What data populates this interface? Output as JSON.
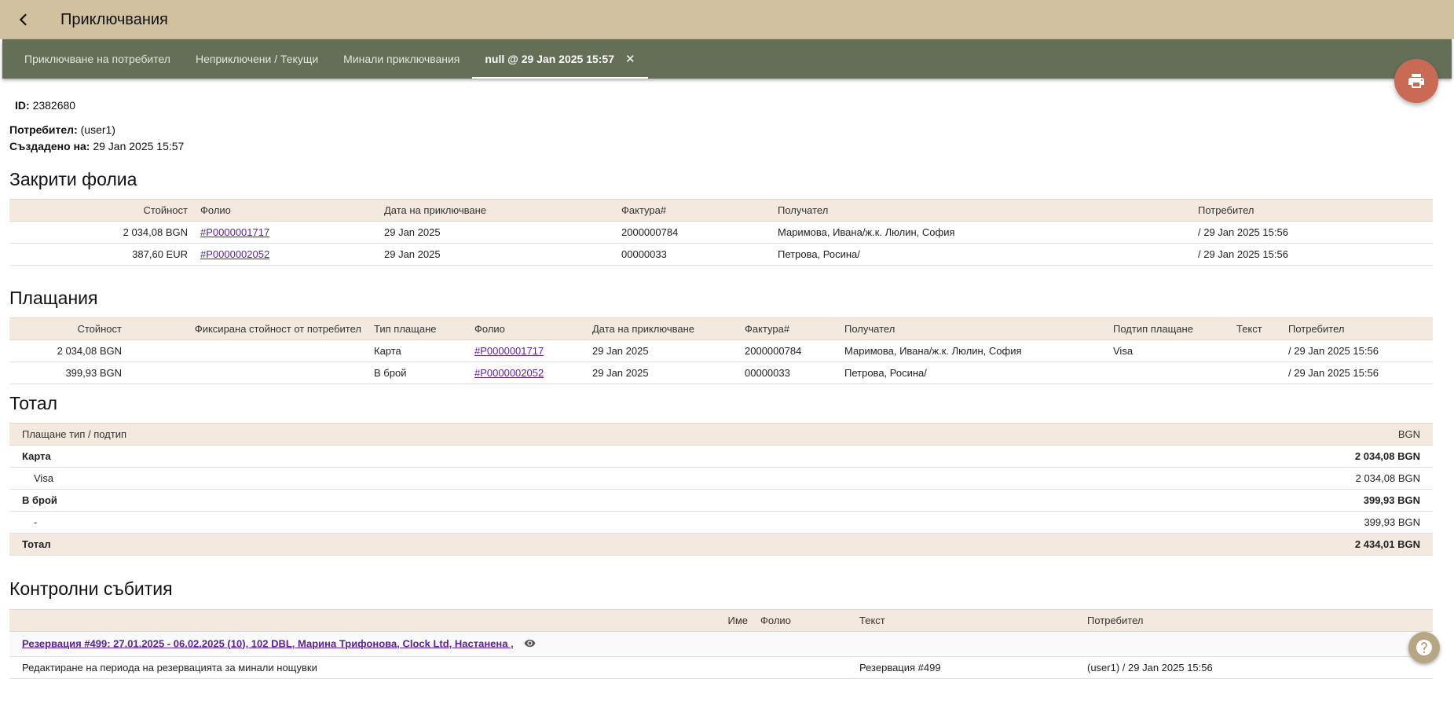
{
  "header": {
    "title": "Приключвания"
  },
  "tabs": [
    {
      "label": "Приключване на потребител"
    },
    {
      "label": "Неприключени / Текущи"
    },
    {
      "label": "Минали приключвания"
    },
    {
      "label": "null @ 29 Jan 2025 15:57",
      "close": "✕"
    }
  ],
  "info": {
    "id_label": "ID:",
    "id_value": "2382680",
    "user_label": "Потребител:",
    "user_value": "(user1)",
    "created_label": "Създадено на:",
    "created_value": "29 Jan 2025 15:57"
  },
  "closed_folios": {
    "title": "Закрити фолиа",
    "columns": [
      "Стойност",
      "Фолио",
      "Дата на приключване",
      "Фактура#",
      "Получател",
      "Потребител"
    ],
    "rows": [
      {
        "value": "2 034,08 BGN",
        "folio": "#P0000001717",
        "date": "29 Jan 2025",
        "invoice": "2000000784",
        "recipient": "Маримова, Ивана/ж.к. Люлин, София",
        "user": "/ 29 Jan 2025 15:56"
      },
      {
        "value": "387,60 EUR",
        "folio": "#P0000002052",
        "date": "29 Jan 2025",
        "invoice": "00000033",
        "recipient": "Петрова, Росина/",
        "user": "/ 29 Jan 2025 15:56"
      }
    ]
  },
  "payments": {
    "title": "Плащания",
    "columns": [
      "Стойност",
      "Фиксирана стойност от потребител",
      "Тип плащане",
      "Фолио",
      "Дата на приключване",
      "Фактура#",
      "Получател",
      "Подтип плащане",
      "Текст",
      "Потребител"
    ],
    "rows": [
      {
        "value": "2 034,08 BGN",
        "fixed": "",
        "type": "Карта",
        "folio": "#P0000001717",
        "date": "29 Jan 2025",
        "invoice": "2000000784",
        "recipient": "Маримова, Ивана/ж.к. Люлин, София",
        "subtype": "Visa",
        "text": "",
        "user": "/ 29 Jan 2025 15:56"
      },
      {
        "value": "399,93 BGN",
        "fixed": "",
        "type": "В брой",
        "folio": "#P0000002052",
        "date": "29 Jan 2025",
        "invoice": "00000033",
        "recipient": "Петрова, Росина/",
        "subtype": "",
        "text": "",
        "user": "/ 29 Jan 2025 15:56"
      }
    ]
  },
  "total": {
    "title": "Тотал",
    "col_type": "Плащане тип / подтип",
    "col_currency": "BGN",
    "rows": [
      {
        "name": "Карта",
        "amount": "2 034,08 BGN"
      },
      {
        "name": "Visa",
        "amount": "2 034,08 BGN"
      },
      {
        "name": "В брой",
        "amount": "399,93 BGN"
      },
      {
        "name": "-",
        "amount": "399,93 BGN"
      },
      {
        "name": "Тотал",
        "amount": "2 434,01 BGN"
      }
    ]
  },
  "events": {
    "title": "Контролни събития",
    "columns": [
      "Име",
      "Фолио",
      "Текст",
      "Потребител"
    ],
    "reservation_link": "Резервация #499: 27.01.2025 - 06.02.2025 (10), 102 DBL, Марина Трифонова, Clock Ltd, Настанена ,",
    "rows": [
      {
        "description": "Редактиране на периода на резервацията за минали нощувки",
        "name": "",
        "folio": "",
        "text": "Резервация #499",
        "user": "(user1) / 29 Jan 2025 15:56"
      }
    ]
  },
  "colors": {
    "topbar": "#d1c19e",
    "tabbar": "#656e56",
    "header_row": "#f3e9de",
    "link": "#5a1fa0",
    "print_fab": "#c96a55",
    "help_fab": "#b7a683"
  },
  "icons": {
    "back": "chevron-left-icon",
    "print": "printer-icon",
    "help": "help-icon",
    "eye": "eye-icon"
  }
}
